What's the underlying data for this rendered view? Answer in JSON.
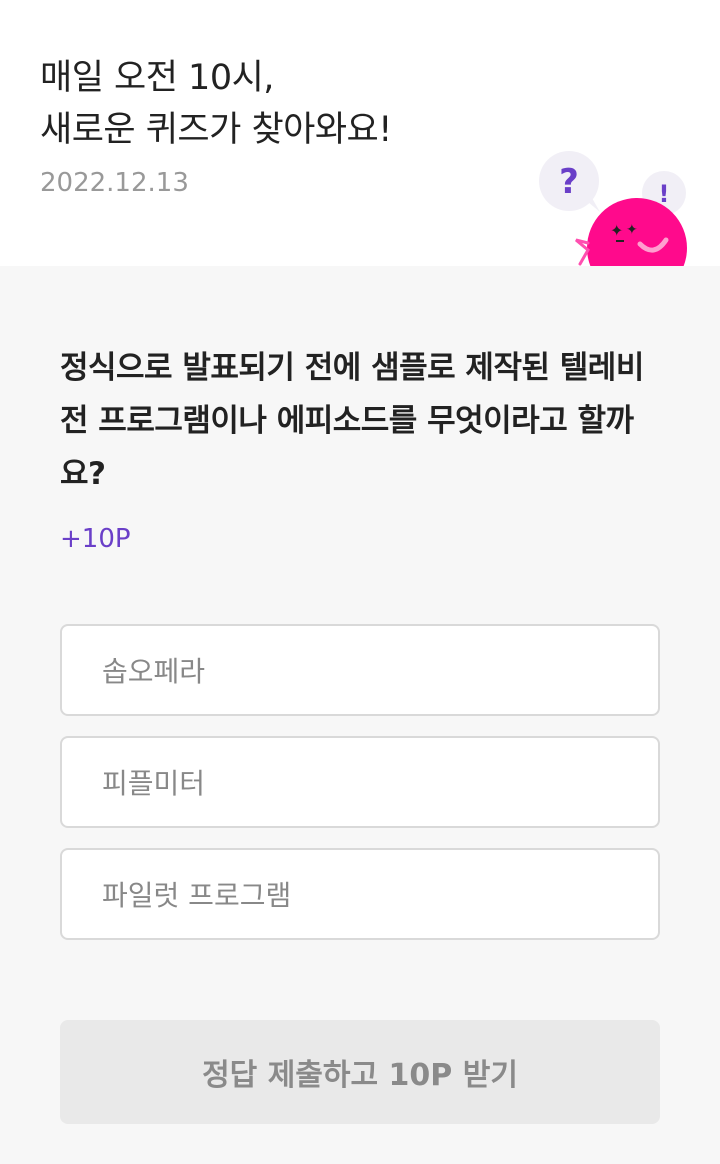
{
  "header": {
    "title_line1": "매일 오전 10시,",
    "title_line2": "새로운 퀴즈가 찾아와요!",
    "date": "2022.12.13",
    "mascot": {
      "icon": "pink-blob-mascot",
      "bubble_question": "?",
      "bubble_exclaim": "!",
      "colors": {
        "body": "#ff0a8c",
        "question_mark": "#6a3fc8"
      }
    }
  },
  "quiz": {
    "question": "정식으로 발표되기 전에 샘플로 제작된 텔레비전 프로그램이나 에피소드를 무엇이라고 할까요?",
    "points": "+10P",
    "options": [
      {
        "label": "솝오페라"
      },
      {
        "label": "피플미터"
      },
      {
        "label": "파일럿 프로그램"
      }
    ],
    "submit_label": "정답 제출하고 10P 받기"
  },
  "colors": {
    "accent": "#6a3fc8",
    "background": "#f7f7f7",
    "button_disabled": "#e9e9e9"
  }
}
